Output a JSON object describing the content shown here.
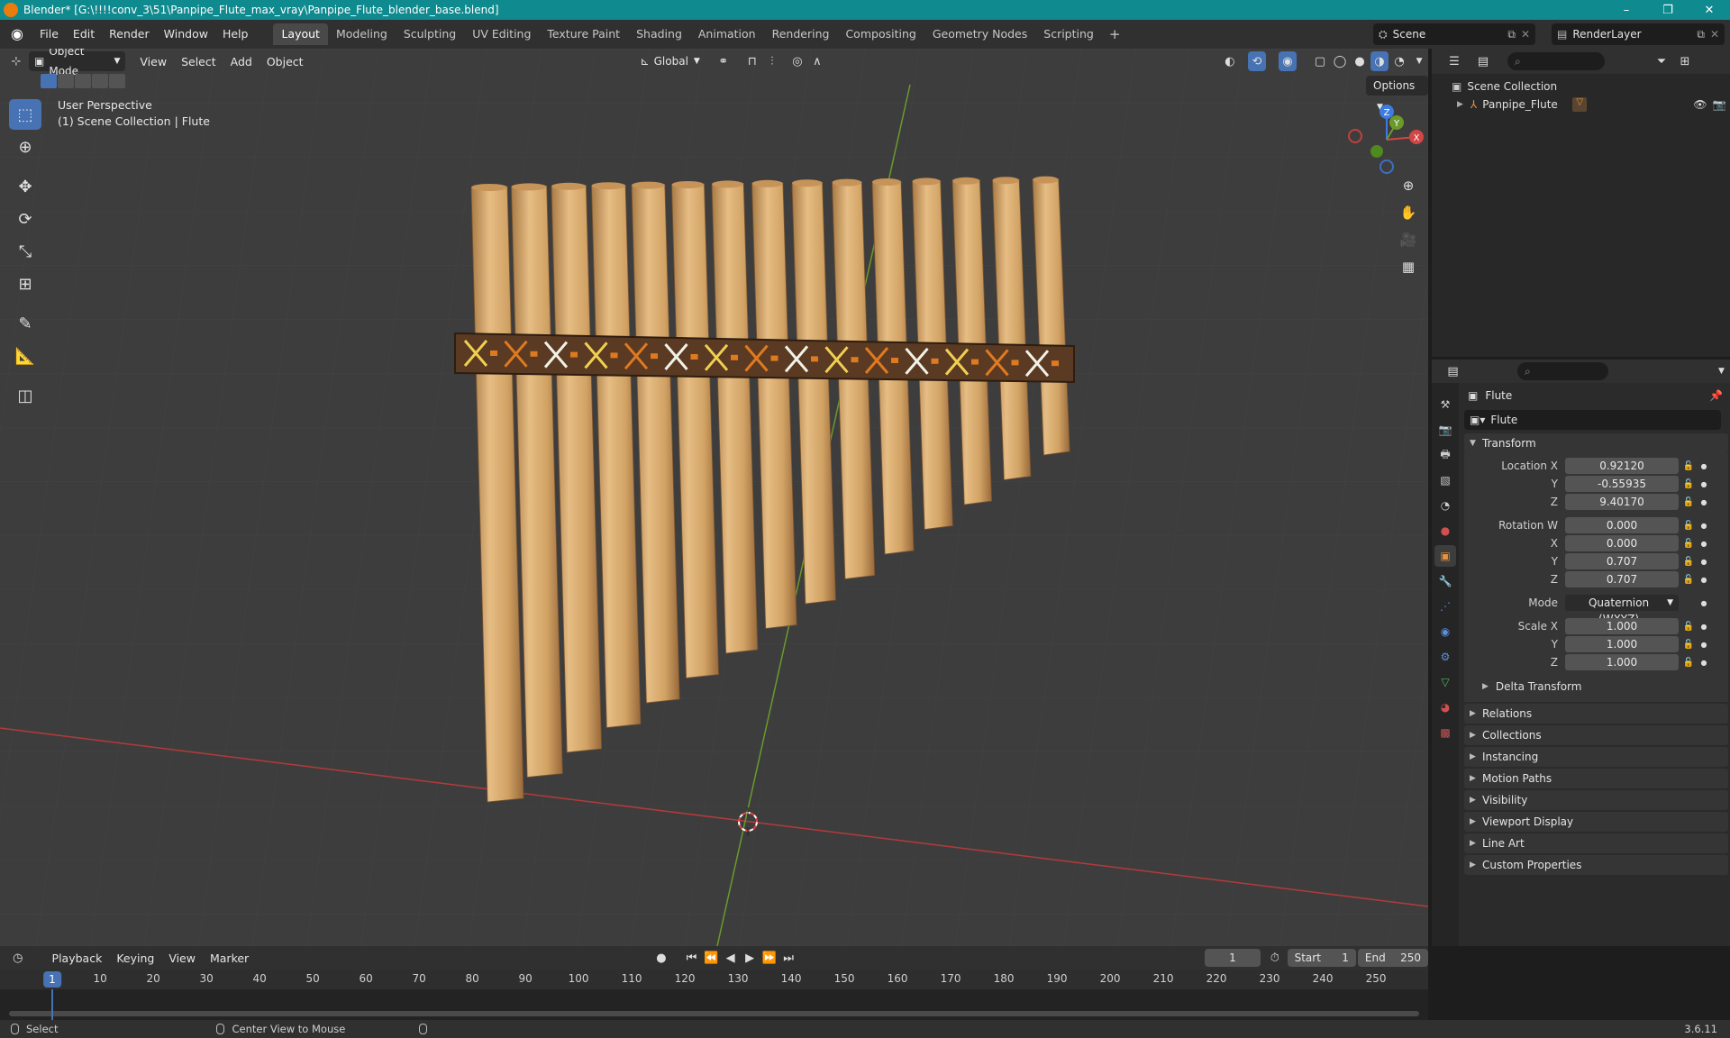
{
  "window": {
    "title": "Blender* [G:\\!!!!conv_3\\51\\Panpipe_Flute_max_vray\\Panpipe_Flute_blender_base.blend]",
    "minimize": "–",
    "maximize": "❐",
    "close": "✕"
  },
  "menu": [
    "File",
    "Edit",
    "Render",
    "Window",
    "Help"
  ],
  "workspaces": [
    "Layout",
    "Modeling",
    "Sculpting",
    "UV Editing",
    "Texture Paint",
    "Shading",
    "Animation",
    "Rendering",
    "Compositing",
    "Geometry Nodes",
    "Scripting"
  ],
  "active_workspace": "Layout",
  "scene": "Scene",
  "view_layer": "RenderLayer",
  "viewport": {
    "mode": "Object Mode",
    "menus": [
      "View",
      "Select",
      "Add",
      "Object"
    ],
    "orientation": "Global",
    "options_label": "Options",
    "view_name": "User Perspective",
    "collection_info": "(1) Scene Collection | Flute",
    "gizmo_axes": {
      "x": "X",
      "y": "Y",
      "z": "Z"
    }
  },
  "outliner": {
    "root": "Scene Collection",
    "items": [
      {
        "name": "Panpipe_Flute"
      }
    ]
  },
  "properties": {
    "object_name": "Flute",
    "data_name": "Flute",
    "transform_label": "Transform",
    "location": {
      "label": "Location X",
      "x": "0.92120",
      "y": "-0.55935",
      "z": "9.40170"
    },
    "rotation": {
      "label": "Rotation W",
      "w": "0.000",
      "x": "0.000",
      "y": "0.707",
      "z": "0.707"
    },
    "mode_label": "Mode",
    "mode_value": "Quaternion (WXYZ)",
    "scale": {
      "label": "Scale X",
      "x": "1.000",
      "y": "1.000",
      "z": "1.000"
    },
    "axis_labels": {
      "y": "Y",
      "z": "Z",
      "x": "X"
    },
    "delta_transform": "Delta Transform",
    "panels": [
      "Relations",
      "Collections",
      "Instancing",
      "Motion Paths",
      "Visibility",
      "Viewport Display",
      "Line Art",
      "Custom Properties"
    ]
  },
  "timeline": {
    "menus": [
      "Playback",
      "Keying",
      "View",
      "Marker"
    ],
    "current_frame": "1",
    "start_label": "Start",
    "start": "1",
    "end_label": "End",
    "end": "250",
    "ticks": [
      "10",
      "20",
      "30",
      "40",
      "50",
      "60",
      "70",
      "80",
      "90",
      "100",
      "110",
      "120",
      "130",
      "140",
      "150",
      "160",
      "170",
      "180",
      "190",
      "200",
      "210",
      "220",
      "230",
      "240",
      "250"
    ]
  },
  "status": {
    "select": "Select",
    "center": "Center View to Mouse",
    "version": "3.6.11"
  },
  "colors": {
    "accent": "#4772b3",
    "titlebar": "#0f8a8f",
    "x_axis": "#b53a3a",
    "y_axis": "#6b9a2b",
    "z_axis": "#3d7be0",
    "wood": "#d4a468"
  }
}
